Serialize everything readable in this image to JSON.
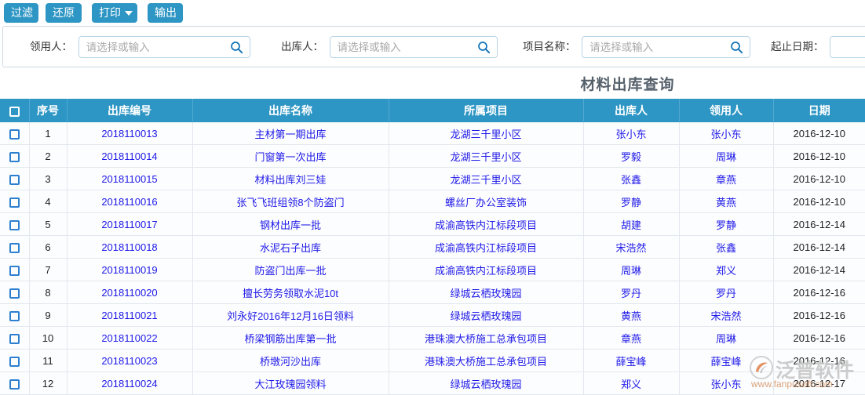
{
  "toolbar": {
    "buttons": [
      {
        "label": "过滤",
        "name": "filter-button"
      },
      {
        "label": "还原",
        "name": "restore-button"
      },
      {
        "label": "打印",
        "name": "print-button",
        "has_caret": true
      },
      {
        "label": "输出",
        "name": "export-button"
      }
    ]
  },
  "filters": [
    {
      "label": "领用人：",
      "placeholder": "请选择或输入",
      "value": "",
      "has_search_icon": true
    },
    {
      "label": "出库人：",
      "placeholder": "请选择或输入",
      "value": "",
      "has_search_icon": true
    },
    {
      "label": "项目名称：",
      "placeholder": "请选择或输入",
      "value": "",
      "has_search_icon": true
    },
    {
      "label": "起止日期：",
      "placeholder": "",
      "value": "",
      "has_search_icon": false
    }
  ],
  "report": {
    "title": "材料出库查询"
  },
  "table": {
    "columns": [
      {
        "key": "checkbox",
        "label": ""
      },
      {
        "key": "index",
        "label": "序号"
      },
      {
        "key": "code",
        "label": "出库编号"
      },
      {
        "key": "name",
        "label": "出库名称"
      },
      {
        "key": "project",
        "label": "所属项目"
      },
      {
        "key": "outer",
        "label": "出库人"
      },
      {
        "key": "receiver",
        "label": "领用人"
      },
      {
        "key": "date",
        "label": "日期"
      }
    ],
    "rows": [
      {
        "index": "1",
        "code": "2018110013",
        "name": "主材第一期出库",
        "project": "龙湖三千里小区",
        "outer": "张小东",
        "receiver": "张小东",
        "date": "2016-12-10"
      },
      {
        "index": "2",
        "code": "2018110014",
        "name": "门窗第一次出库",
        "project": "龙湖三千里小区",
        "outer": "罗毅",
        "receiver": "周琳",
        "date": "2016-12-10"
      },
      {
        "index": "3",
        "code": "2018110015",
        "name": "材料出库刘三娃",
        "project": "龙湖三千里小区",
        "outer": "张鑫",
        "receiver": "章燕",
        "date": "2016-12-10"
      },
      {
        "index": "4",
        "code": "2018110016",
        "name": "张飞飞班组领8个防盗门",
        "project": "螺丝厂办公室装饰",
        "outer": "罗静",
        "receiver": "黄燕",
        "date": "2016-12-10"
      },
      {
        "index": "5",
        "code": "2018110017",
        "name": "钢材出库一批",
        "project": "成渝高铁内江标段项目",
        "outer": "胡建",
        "receiver": "罗静",
        "date": "2016-12-14"
      },
      {
        "index": "6",
        "code": "2018110018",
        "name": "水泥石子出库",
        "project": "成渝高铁内江标段项目",
        "outer": "宋浩然",
        "receiver": "张鑫",
        "date": "2016-12-14"
      },
      {
        "index": "7",
        "code": "2018110019",
        "name": "防盗门出库一批",
        "project": "成渝高铁内江标段项目",
        "outer": "周琳",
        "receiver": "郑义",
        "date": "2016-12-14"
      },
      {
        "index": "8",
        "code": "2018110020",
        "name": "擅长劳务领取水泥10t",
        "project": "绿城云栖玫瑰园",
        "outer": "罗丹",
        "receiver": "罗丹",
        "date": "2016-12-16"
      },
      {
        "index": "9",
        "code": "2018110021",
        "name": "刘永好2016年12月16日领料",
        "project": "绿城云栖玫瑰园",
        "outer": "黄燕",
        "receiver": "宋浩然",
        "date": "2016-12-16"
      },
      {
        "index": "10",
        "code": "2018110022",
        "name": "桥梁钢筋出库第一批",
        "project": "港珠澳大桥施工总承包项目",
        "outer": "章燕",
        "receiver": "周琳",
        "date": "2016-12-16"
      },
      {
        "index": "11",
        "code": "2018110023",
        "name": "桥墩河沙出库",
        "project": "港珠澳大桥施工总承包项目",
        "outer": "薛宝峰",
        "receiver": "薛宝峰",
        "date": "2016-12-16"
      },
      {
        "index": "12",
        "code": "2018110024",
        "name": "大江玫瑰园领料",
        "project": "绿城云栖玫瑰园",
        "outer": "郑义",
        "receiver": "张小东",
        "date": "2016-12-17"
      }
    ]
  },
  "watermark": {
    "name": "泛普软件",
    "url": "www.fanpusoft.com"
  },
  "colors": {
    "accent": "#2e96c4",
    "header_bg": "#2e96c4",
    "link": "#1f19e8",
    "title": "#55606b",
    "row_bg": "#fcfdfe",
    "grid_line": "#e2e8ef"
  }
}
